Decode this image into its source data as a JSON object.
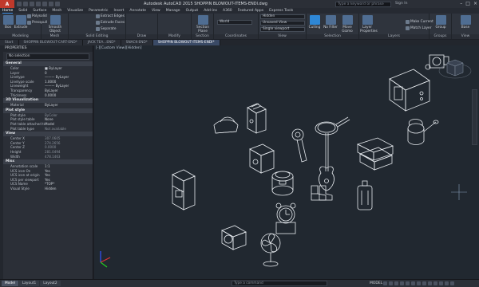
{
  "titlebar": {
    "app": "A",
    "title": "Autodesk AutoCAD 2015   SHOPPIN BLOWOUT-ITEMS-ENDl.dwg",
    "search_placeholder": "Type a keyword or phrase",
    "user": "Sign In"
  },
  "menubar": [
    "Home",
    "Solid",
    "Surface",
    "Mesh",
    "Visualize",
    "Parametric",
    "Insert",
    "Annotate",
    "View",
    "Manage",
    "Output",
    "Add-ins",
    "A360",
    "Featured Apps",
    "Express Tools"
  ],
  "ribbon": {
    "panels": {
      "modeling": "Modeling",
      "mesh": "Mesh",
      "solid_editing": "Solid Editing",
      "draw": "Draw",
      "modify": "Modify",
      "section": "Section",
      "coordinates": "Coordinates",
      "view": "View",
      "selection": "Selection",
      "layers": "Layers",
      "groups": "Groups",
      "view2": "View"
    },
    "tools": {
      "box": "Box",
      "extrude": "Extrude",
      "polysolid": "Polysolid",
      "presspull": "Presspull",
      "smooth_object": "Smooth Object",
      "extract_edges": "Extract Edges",
      "extrude_faces": "Extrude Faces",
      "separate": "Separate",
      "section_plane": "Section Plane",
      "world": "World",
      "hidden": "Hidden",
      "unsaved_view": "Unsaved View",
      "single_viewport": "Single viewport",
      "culling": "Culling",
      "no_filter": "No Filter",
      "move_gizmo": "Move Gizmo",
      "layer_properties": "Layer Properties",
      "make_current": "Make Current",
      "match_layer": "Match Layer",
      "group": "Group",
      "base": "Base"
    }
  },
  "doctabs": [
    "Start",
    "SHOPPIN BLOWOUT-CART-END*",
    "JACK TEA...END*",
    "SNACK-END*",
    "SHOPPIN BLOWOUT-ITEMS-ENDl*"
  ],
  "properties": {
    "title": "PROPERTIES",
    "selection": "No selection",
    "sections": [
      {
        "name": "General",
        "rows": [
          {
            "k": "Color",
            "v": "■ ByLayer"
          },
          {
            "k": "Layer",
            "v": "0"
          },
          {
            "k": "Linetype",
            "v": "——— ByLayer"
          },
          {
            "k": "Linetype scale",
            "v": "1.0000"
          },
          {
            "k": "Lineweight",
            "v": "——— ByLayer"
          },
          {
            "k": "Transparency",
            "v": "ByLayer"
          },
          {
            "k": "Thickness",
            "v": "0.0000"
          }
        ]
      },
      {
        "name": "3D Visualization",
        "rows": [
          {
            "k": "Material",
            "v": "ByLayer"
          }
        ]
      },
      {
        "name": "Plot style",
        "rows": [
          {
            "k": "Plot style",
            "v": "ByColor",
            "dim": true
          },
          {
            "k": "Plot style table",
            "v": "None"
          },
          {
            "k": "Plot table attached to",
            "v": "Model"
          },
          {
            "k": "Plot table type",
            "v": "Not available",
            "dim": true
          }
        ]
      },
      {
        "name": "View",
        "rows": [
          {
            "k": "Center X",
            "v": "307.0605",
            "dim": true
          },
          {
            "k": "Center Y",
            "v": "274.2656",
            "dim": true
          },
          {
            "k": "Center Z",
            "v": "0.0000",
            "dim": true
          },
          {
            "k": "Height",
            "v": "281.0494",
            "dim": true
          },
          {
            "k": "Width",
            "v": "478.1463",
            "dim": true
          }
        ]
      },
      {
        "name": "Misc",
        "rows": [
          {
            "k": "Annotation scale",
            "v": "1:1"
          },
          {
            "k": "UCS icon On",
            "v": "Yes"
          },
          {
            "k": "UCS icon at origin",
            "v": "Yes"
          },
          {
            "k": "UCS per viewport",
            "v": "Yes"
          },
          {
            "k": "UCS Name",
            "v": "*TOP*"
          },
          {
            "k": "Visual Style",
            "v": "Hidden"
          }
        ]
      }
    ]
  },
  "viewport": {
    "label": "[-][Custom View][Hidden]",
    "viewcube_face": "",
    "wcs": "WCS"
  },
  "statusbar": {
    "tabs": [
      "Model",
      "Layout1",
      "Layout2"
    ],
    "command_placeholder": "Type a command",
    "mode": "MODEL"
  },
  "colors": {
    "viewport_bg": "#212830",
    "accent": "#2e87d6",
    "ucs_x": "#d33",
    "ucs_y": "#2c2",
    "ucs_z": "#35f"
  }
}
